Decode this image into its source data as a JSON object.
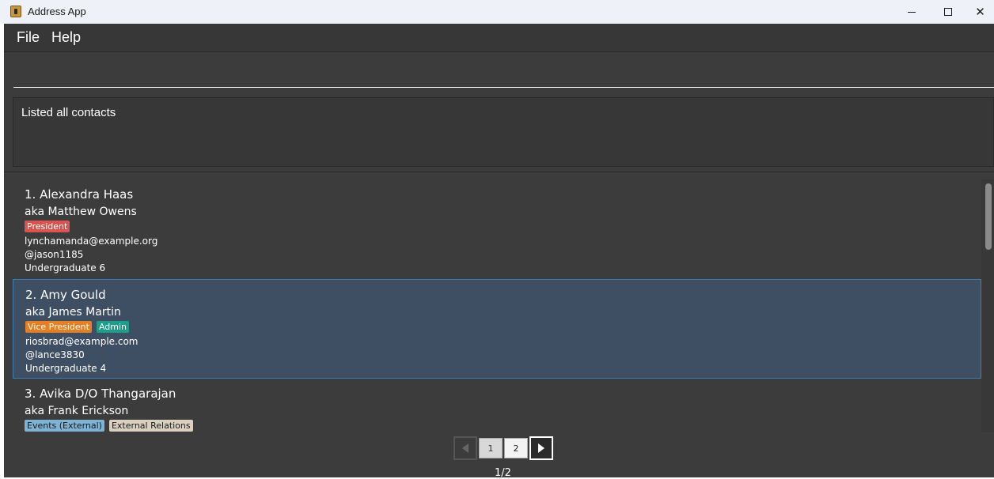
{
  "window": {
    "title": "Address App",
    "minimize_glyph": "",
    "maximize_glyph": "",
    "close_glyph": "✕"
  },
  "menu": {
    "file": "File",
    "help": "Help"
  },
  "command": {
    "value": "",
    "placeholder": ""
  },
  "result": {
    "message": "Listed all contacts"
  },
  "colors": {
    "accent": "#3a7eb5",
    "tag_president": "#d9534f",
    "tag_vice_president": "#e67e22",
    "tag_admin": "#1e9e8a",
    "tag_events_external": "#7fb3d5",
    "tag_external_relations": "#d9d0c1"
  },
  "contacts": [
    {
      "name": "1. Alexandra Haas",
      "alias": "aka Matthew Owens",
      "tags": [
        {
          "label": "President",
          "color": "#d9534f",
          "text_color": "#ffffff"
        }
      ],
      "email": "lynchamanda@example.org",
      "telegram": "@jason1185",
      "year": "Undergraduate 6",
      "selected": false
    },
    {
      "name": "2. Amy Gould",
      "alias": "aka James Martin",
      "tags": [
        {
          "label": "Vice President",
          "color": "#e67e22",
          "text_color": "#ffffff"
        },
        {
          "label": "Admin",
          "color": "#1e9e8a",
          "text_color": "#ffffff"
        }
      ],
      "email": "riosbrad@example.com",
      "telegram": "@lance3830",
      "year": "Undergraduate 4",
      "selected": true
    },
    {
      "name": "3. Avika D/O Thangarajan",
      "alias": "aka Frank Erickson",
      "tags": [
        {
          "label": "Events (External)",
          "color": "#7fb3d5",
          "text_color": "#1a1a1a"
        },
        {
          "label": "External Relations",
          "color": "#d9d0c1",
          "text_color": "#1a1a1a"
        }
      ],
      "email": "",
      "telegram": "",
      "year": "",
      "selected": false
    }
  ],
  "pagination": {
    "pages": [
      "1",
      "2"
    ],
    "current_page": "1",
    "indicator": "1/2"
  },
  "icons": {
    "app": "address-book-icon",
    "prev": "triangle-left-icon",
    "next": "triangle-right-icon"
  }
}
